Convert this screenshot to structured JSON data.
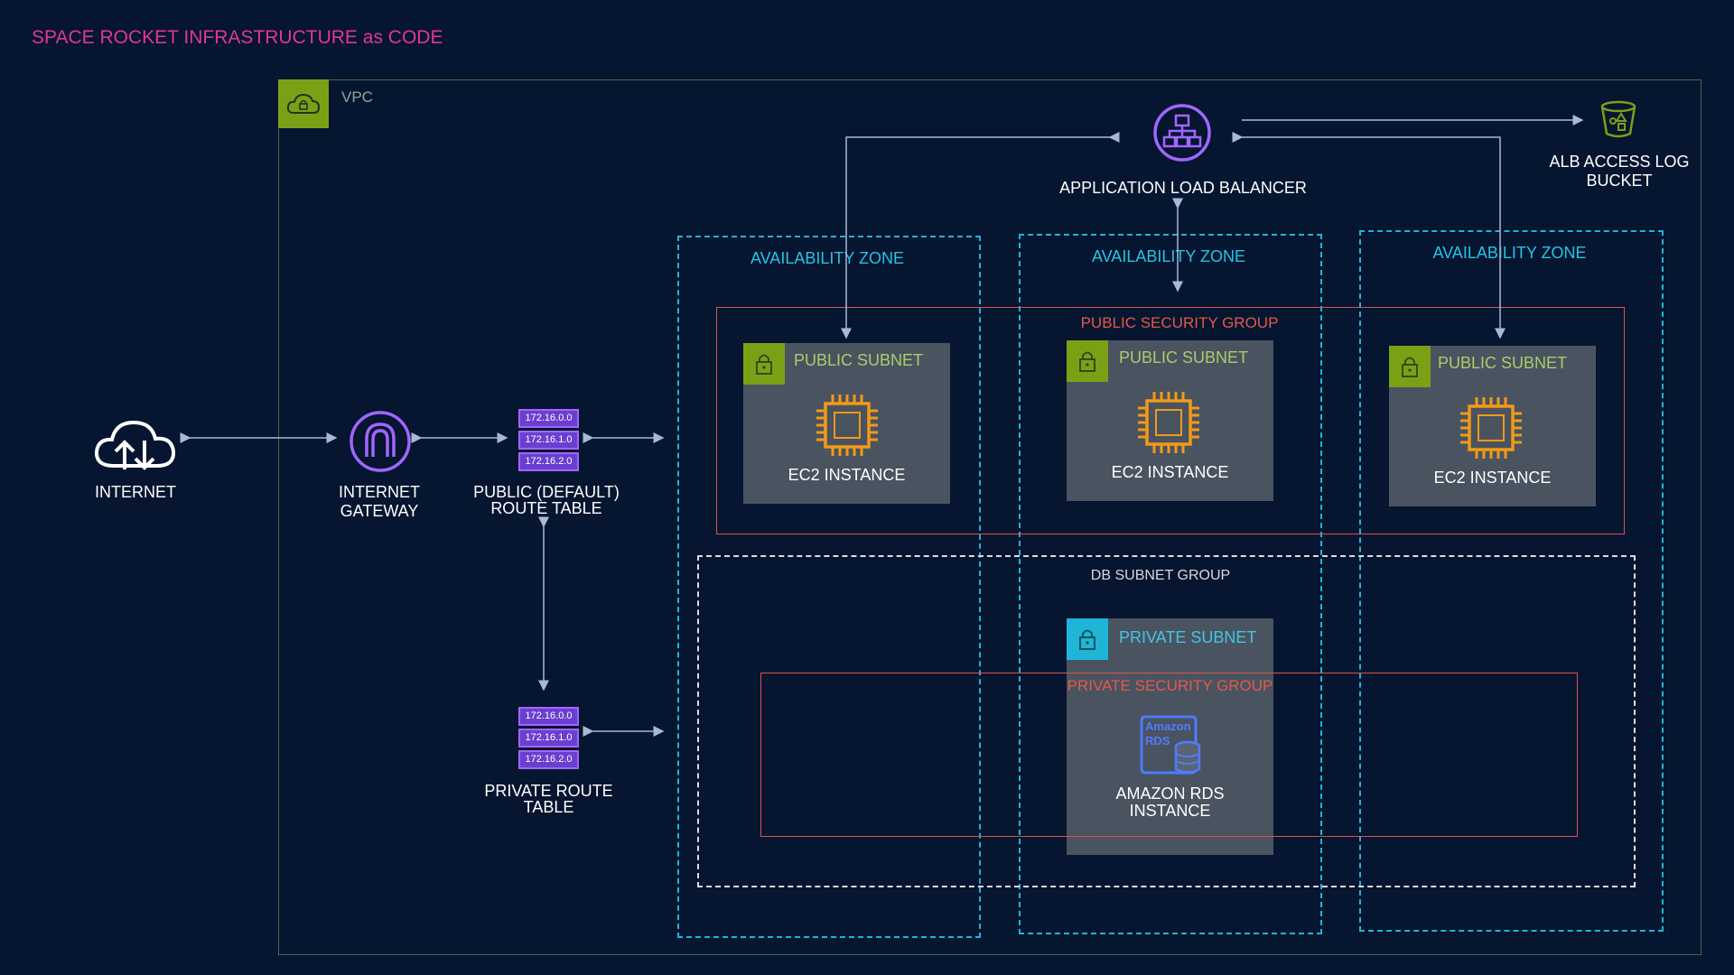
{
  "title": "SPACE ROCKET INFRASTRUCTURE as CODE",
  "vpc": {
    "label": "VPC"
  },
  "nodes": {
    "internet": "INTERNET",
    "igw_line1": "INTERNET",
    "igw_line2": "GATEWAY",
    "public_rt_line1": "PUBLIC (DEFAULT)",
    "public_rt_line2": "ROUTE TABLE",
    "private_rt_line1": "PRIVATE ROUTE",
    "private_rt_line2": "TABLE",
    "alb": "APPLICATION LOAD BALANCER",
    "bucket_line1": "ALB ACCESS LOG",
    "bucket_line2": "BUCKET"
  },
  "route_table_cidrs": [
    "172.16.0.0",
    "172.16.1.0",
    "172.16.2.0"
  ],
  "availability_zones": [
    "AVAILABILITY ZONE",
    "AVAILABILITY ZONE",
    "AVAILABILITY ZONE"
  ],
  "public_security_group": "PUBLIC SECURITY GROUP",
  "public_subnets": [
    {
      "label": "PUBLIC SUBNET",
      "instance": "EC2 INSTANCE"
    },
    {
      "label": "PUBLIC SUBNET",
      "instance": "EC2 INSTANCE"
    },
    {
      "label": "PUBLIC SUBNET",
      "instance": "EC2 INSTANCE"
    }
  ],
  "db_subnet_group": "DB SUBNET GROUP",
  "private_subnet": "PRIVATE SUBNET",
  "private_security_group": "PRIVATE SECURITY GROUP",
  "rds": {
    "icon_line1": "Amazon",
    "icon_line2": "RDS",
    "line1": "AMAZON RDS",
    "line2": "INSTANCE"
  },
  "colors": {
    "background": "#061530",
    "title": "#e0369a",
    "az_border": "#1fb5d6",
    "security_group": "#d9534f",
    "public_subnet": "#7aa116",
    "private_subnet": "#1fb5d6",
    "ec2": "#f29a17",
    "network_icon": "#a166ff"
  }
}
